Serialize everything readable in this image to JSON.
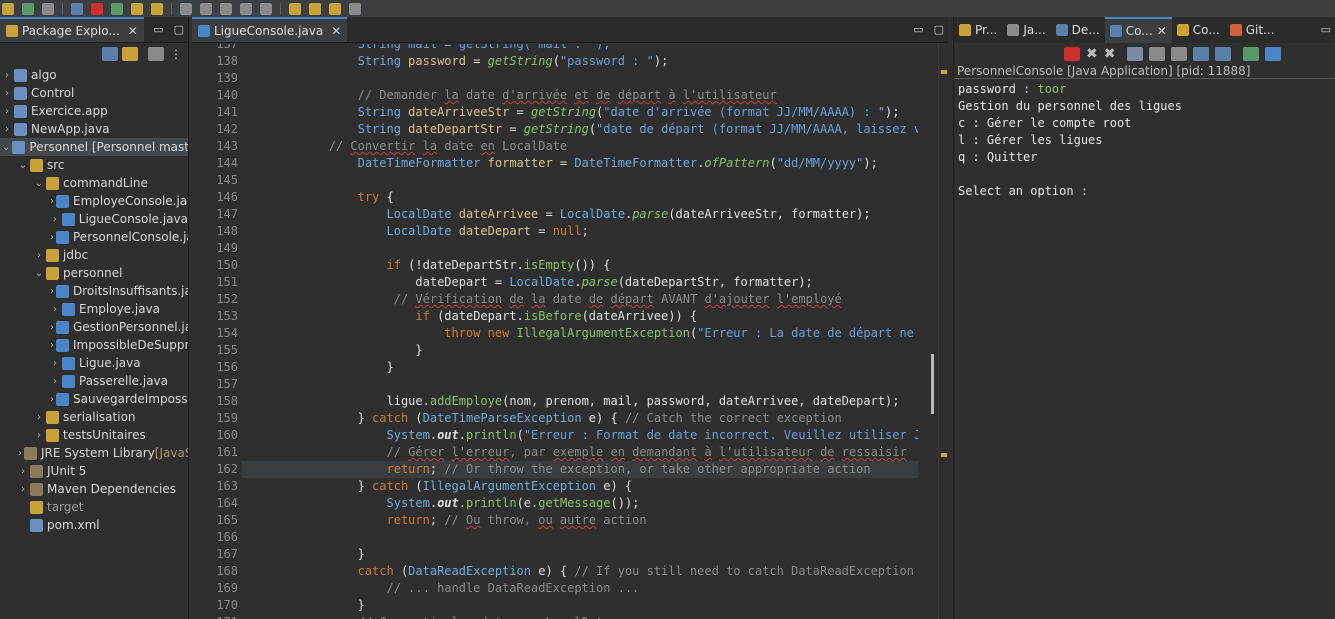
{
  "colors": {
    "accent": "#4a86c7",
    "keyword": "#cc7832",
    "type": "#6fa9dc",
    "string": "#6a9fd8",
    "comment": "#8a8a8a",
    "method": "#86c268",
    "variable": "#d7c28a"
  },
  "package_explorer": {
    "tab_label": "Package Explo...",
    "tree": [
      {
        "label": "algo",
        "icon": "project-icon",
        "indent": 0,
        "arrow": "›"
      },
      {
        "label": "Control",
        "icon": "project-icon",
        "indent": 0,
        "arrow": "›"
      },
      {
        "label": "Exercice.app",
        "icon": "project-icon",
        "indent": 0,
        "arrow": "›"
      },
      {
        "label": "NewApp.java",
        "icon": "project-icon",
        "indent": 0,
        "arrow": "›"
      },
      {
        "label": "Personnel [Personnel master]",
        "icon": "project-icon",
        "indent": 0,
        "arrow": "⌄",
        "selected": true
      },
      {
        "label": "src",
        "icon": "source-folder-icon",
        "indent": 1,
        "arrow": "⌄"
      },
      {
        "label": "commandLine",
        "icon": "package-icon",
        "indent": 2,
        "arrow": "⌄"
      },
      {
        "label": "EmployeConsole.java",
        "icon": "java-file-icon",
        "indent": 3,
        "arrow": "›"
      },
      {
        "label": "LigueConsole.java",
        "icon": "java-file-icon",
        "indent": 3,
        "arrow": "›"
      },
      {
        "label": "PersonnelConsole.java",
        "icon": "java-file-icon",
        "indent": 3,
        "arrow": "›"
      },
      {
        "label": "jdbc",
        "icon": "package-icon",
        "indent": 2,
        "arrow": "›"
      },
      {
        "label": "personnel",
        "icon": "package-icon",
        "indent": 2,
        "arrow": "⌄"
      },
      {
        "label": "DroitsInsuffisants.java",
        "icon": "java-file-icon",
        "indent": 3,
        "arrow": "›"
      },
      {
        "label": "Employe.java",
        "icon": "java-file-icon",
        "indent": 3,
        "arrow": "›"
      },
      {
        "label": "GestionPersonnel.java",
        "icon": "java-file-icon",
        "indent": 3,
        "arrow": "›"
      },
      {
        "label": "ImpossibleDeSupprimer",
        "icon": "java-file-icon",
        "indent": 3,
        "arrow": "›"
      },
      {
        "label": "Ligue.java",
        "icon": "java-file-icon",
        "indent": 3,
        "arrow": "›"
      },
      {
        "label": "Passerelle.java",
        "icon": "java-file-icon",
        "indent": 3,
        "arrow": "›"
      },
      {
        "label": "SauvegardeImpossible",
        "icon": "java-file-icon",
        "indent": 3,
        "arrow": "›"
      },
      {
        "label": "serialisation",
        "icon": "package-icon",
        "indent": 2,
        "arrow": "›"
      },
      {
        "label": "testsUnitaires",
        "icon": "package-icon",
        "indent": 2,
        "arrow": "›"
      },
      {
        "label": "JRE System Library",
        "suffix": "[JavaSE",
        "icon": "library-icon",
        "indent": 1,
        "arrow": "›"
      },
      {
        "label": "JUnit 5",
        "icon": "library-icon",
        "indent": 1,
        "arrow": "›"
      },
      {
        "label": "Maven Dependencies",
        "icon": "library-icon",
        "indent": 1,
        "arrow": "›"
      },
      {
        "label": "target",
        "icon": "folder-icon",
        "indent": 1,
        "arrow": "",
        "dim": true
      },
      {
        "label": "pom.xml",
        "icon": "xml-file-icon",
        "indent": 1,
        "arrow": ""
      }
    ]
  },
  "editor": {
    "tab_label": "LigueConsole.java",
    "first_line": 137,
    "current_line": 162,
    "lines": [
      [
        [
          "s",
          "                String mail = getString(\"mail : \");"
        ]
      ],
      [
        [
          "t",
          "                String "
        ],
        [
          "v",
          "password"
        ],
        [
          "p",
          " = "
        ],
        [
          "mi",
          "getString"
        ],
        [
          "p",
          "("
        ],
        [
          "s",
          "\"password : \""
        ],
        [
          "p",
          ");"
        ]
      ],
      [
        [
          "p",
          ""
        ]
      ],
      [
        [
          "c",
          "                // Demander "
        ],
        [
          "c ul",
          "la"
        ],
        [
          "c",
          " date "
        ],
        [
          "c ul",
          "d'arrivée"
        ],
        [
          "c",
          " "
        ],
        [
          "c ul",
          "et"
        ],
        [
          "c",
          " "
        ],
        [
          "c ul",
          "de"
        ],
        [
          "c",
          " "
        ],
        [
          "c ul",
          "départ"
        ],
        [
          "c",
          " "
        ],
        [
          "c ul",
          "à"
        ],
        [
          "c",
          " "
        ],
        [
          "c ul",
          "l'utilisateur"
        ]
      ],
      [
        [
          "t",
          "                String "
        ],
        [
          "v",
          "dateArriveeStr"
        ],
        [
          "p",
          " = "
        ],
        [
          "mi",
          "getString"
        ],
        [
          "p",
          "("
        ],
        [
          "s",
          "\"date d'arrivée (format JJ/MM/AAAA) : \""
        ],
        [
          "p",
          ");"
        ]
      ],
      [
        [
          "t",
          "                String "
        ],
        [
          "v",
          "dateDepartStr"
        ],
        [
          "p",
          " = "
        ],
        [
          "mi",
          "getString"
        ],
        [
          "p",
          "("
        ],
        [
          "s",
          "\"date de départ (format JJ/MM/AAAA, laissez vide si aucune) : \""
        ],
        [
          "p",
          ");"
        ]
      ],
      [
        [
          "c",
          "            // "
        ],
        [
          "c ul",
          "Convertir"
        ],
        [
          "c",
          " "
        ],
        [
          "c ul",
          "la"
        ],
        [
          "c",
          " date "
        ],
        [
          "c ul",
          "en"
        ],
        [
          "c",
          " LocalDate"
        ]
      ],
      [
        [
          "t",
          "                DateTimeFormatter "
        ],
        [
          "v",
          "formatter"
        ],
        [
          "p",
          " = "
        ],
        [
          "t",
          "DateTimeFormatter"
        ],
        [
          "p",
          "."
        ],
        [
          "mi",
          "ofPattern"
        ],
        [
          "p",
          "("
        ],
        [
          "s",
          "\"dd/MM/yyyy\""
        ],
        [
          "p",
          ");"
        ]
      ],
      [
        [
          "p",
          ""
        ]
      ],
      [
        [
          "k",
          "                try"
        ],
        [
          "p",
          " {"
        ]
      ],
      [
        [
          "t",
          "                    LocalDate "
        ],
        [
          "v",
          "dateArrivee"
        ],
        [
          "p",
          " = "
        ],
        [
          "t",
          "LocalDate"
        ],
        [
          "p",
          "."
        ],
        [
          "mi",
          "parse"
        ],
        [
          "p",
          "(dateArriveeStr, formatter);"
        ]
      ],
      [
        [
          "t",
          "                    LocalDate "
        ],
        [
          "v",
          "dateDepart"
        ],
        [
          "p",
          " = "
        ],
        [
          "k",
          "null"
        ],
        [
          "p",
          ";"
        ]
      ],
      [
        [
          "p",
          ""
        ]
      ],
      [
        [
          "k",
          "                    if"
        ],
        [
          "p",
          " (!dateDepartStr."
        ],
        [
          "m",
          "isEmpty"
        ],
        [
          "p",
          "()) {"
        ]
      ],
      [
        [
          "p",
          "                        dateDepart = "
        ],
        [
          "t",
          "LocalDate"
        ],
        [
          "p",
          "."
        ],
        [
          "mi",
          "parse"
        ],
        [
          "p",
          "(dateDepartStr, formatter);"
        ]
      ],
      [
        [
          "c",
          "                     // "
        ],
        [
          "c ul",
          "Vérification"
        ],
        [
          "c",
          " "
        ],
        [
          "c ul",
          "de"
        ],
        [
          "c",
          " "
        ],
        [
          "c ul",
          "la"
        ],
        [
          "c",
          " date "
        ],
        [
          "c ul",
          "de"
        ],
        [
          "c",
          " "
        ],
        [
          "c ul",
          "départ"
        ],
        [
          "c",
          " AVANT "
        ],
        [
          "c ul",
          "d'ajouter"
        ],
        [
          "c",
          " "
        ],
        [
          "c ul",
          "l'employé"
        ]
      ],
      [
        [
          "k",
          "                        if"
        ],
        [
          "p",
          " (dateDepart."
        ],
        [
          "m",
          "isBefore"
        ],
        [
          "p",
          "(dateArrivee)) {"
        ]
      ],
      [
        [
          "k",
          "                            throw new "
        ],
        [
          "m",
          "IllegalArgumentException"
        ],
        [
          "p",
          "("
        ],
        [
          "s",
          "\"Erreur : La date de départ ne peut pas être avant la date d'arrivée.\""
        ],
        [
          "p",
          ");"
        ]
      ],
      [
        [
          "p",
          "                        }"
        ]
      ],
      [
        [
          "p",
          "                    }"
        ]
      ],
      [
        [
          "p",
          ""
        ]
      ],
      [
        [
          "p",
          "                    ligue."
        ],
        [
          "m",
          "addEmploye"
        ],
        [
          "p",
          "(nom, prenom, mail, password, dateArrivee, dateDepart);"
        ]
      ],
      [
        [
          "p",
          "                } "
        ],
        [
          "k",
          "catch"
        ],
        [
          "p",
          " ("
        ],
        [
          "t",
          "DateTimeParseException"
        ],
        [
          "p",
          " e) { "
        ],
        [
          "c",
          "// Catch the correct exception"
        ]
      ],
      [
        [
          "t",
          "                    System"
        ],
        [
          "p",
          "."
        ],
        [
          "sf",
          "out"
        ],
        [
          "p",
          "."
        ],
        [
          "m",
          "println"
        ],
        [
          "p",
          "("
        ],
        [
          "s",
          "\"Erreur : Format de date incorrect. Veuillez utiliser JJ/MM/AAAA.\""
        ],
        [
          "p",
          ");"
        ]
      ],
      [
        [
          "c",
          "                    // "
        ],
        [
          "c ul",
          "Gérer"
        ],
        [
          "c",
          " "
        ],
        [
          "c ul",
          "l'erreur"
        ],
        [
          "c",
          ", par "
        ],
        [
          "c ul",
          "exemple"
        ],
        [
          "c",
          " "
        ],
        [
          "c ul",
          "en"
        ],
        [
          "c",
          " "
        ],
        [
          "c ul",
          "demandant"
        ],
        [
          "c",
          " "
        ],
        [
          "c ul",
          "à"
        ],
        [
          "c",
          " "
        ],
        [
          "c ul",
          "l'utilisateur"
        ],
        [
          "c",
          " "
        ],
        [
          "c ul",
          "de"
        ],
        [
          "c",
          " "
        ],
        [
          "c ul",
          "ressaisir"
        ]
      ],
      [
        [
          "k",
          "                    return"
        ],
        [
          "p",
          "; "
        ],
        [
          "c",
          "// Or throw the exception, or take other appropriate action"
        ]
      ],
      [
        [
          "p",
          "                } "
        ],
        [
          "k",
          "catch"
        ],
        [
          "p",
          " ("
        ],
        [
          "t",
          "IllegalArgumentException"
        ],
        [
          "p",
          " e) {"
        ]
      ],
      [
        [
          "t",
          "                    System"
        ],
        [
          "p",
          "."
        ],
        [
          "sf",
          "out"
        ],
        [
          "p",
          "."
        ],
        [
          "m",
          "println"
        ],
        [
          "p",
          "(e."
        ],
        [
          "m",
          "getMessage"
        ],
        [
          "p",
          "());"
        ]
      ],
      [
        [
          "k",
          "                    return"
        ],
        [
          "p",
          "; "
        ],
        [
          "c",
          "// "
        ],
        [
          "c ul",
          "Ou"
        ],
        [
          "c",
          " throw, "
        ],
        [
          "c ul",
          "ou"
        ],
        [
          "c",
          " "
        ],
        [
          "c ul",
          "autre"
        ],
        [
          "c",
          " action"
        ]
      ],
      [
        [
          "p",
          ""
        ]
      ],
      [
        [
          "p",
          "                }"
        ]
      ],
      [
        [
          "k",
          "                catch"
        ],
        [
          "p",
          " ("
        ],
        [
          "t",
          "DataReadException"
        ],
        [
          "p",
          " e) { "
        ],
        [
          "c",
          "// If you still need to catch DataReadException"
        ]
      ],
      [
        [
          "c",
          "                    // ... handle DataReadException ..."
        ]
      ],
      [
        [
          "p",
          "                }"
        ]
      ],
      [
        [
          "c",
          "                // Convertir les dates en LocalDate"
        ]
      ]
    ]
  },
  "console": {
    "tabs": [
      {
        "label": "Pr...",
        "icon": "problems-icon"
      },
      {
        "label": "Ja...",
        "icon": "javadoc-icon"
      },
      {
        "label": "De...",
        "icon": "declaration-icon"
      },
      {
        "label": "Co...",
        "icon": "console-icon",
        "active": true
      },
      {
        "label": "Co...",
        "icon": "coverage-icon"
      },
      {
        "label": "Git...",
        "icon": "git-icon"
      }
    ],
    "title": "PersonnelConsole [Java Application]  [pid: 11888]",
    "output": [
      {
        "text": "password : ",
        "input": "toor"
      },
      {
        "text": "Gestion du personnel des ligues"
      },
      {
        "text": "c : Gérer le compte root"
      },
      {
        "text": "l : Gérer les ligues"
      },
      {
        "text": "q : Quitter"
      },
      {
        "text": ""
      },
      {
        "text": "Select an option :"
      }
    ]
  }
}
